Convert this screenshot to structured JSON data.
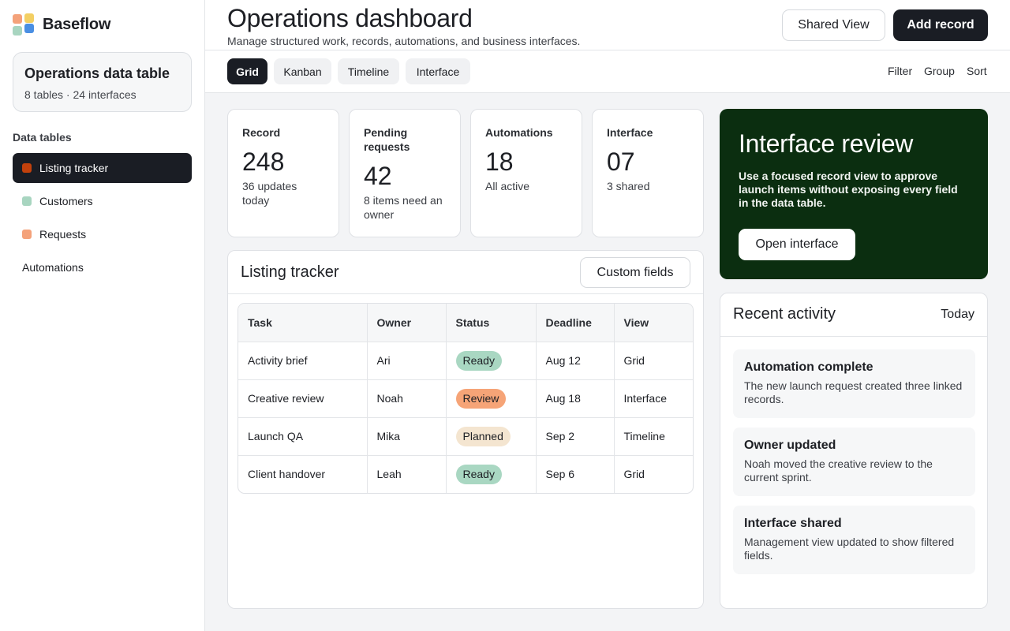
{
  "brand": {
    "name": "Baseflow"
  },
  "workspace": {
    "title": "Operations data table",
    "subtitle": "8 tables · 24 interfaces"
  },
  "sidebar": {
    "section_label": "Data tables",
    "items": [
      {
        "label": "Listing tracker",
        "color": "#c2410c",
        "active": true
      },
      {
        "label": "Customers",
        "color": "#a8d5c0",
        "active": false
      },
      {
        "label": "Requests",
        "color": "#f4a27a",
        "active": false
      }
    ],
    "automations_label": "Automations"
  },
  "header": {
    "title": "Operations dashboard",
    "subtitle": "Manage structured work, records, automations, and business interfaces.",
    "shared_view_label": "Shared View",
    "add_record_label": "Add record"
  },
  "tabs": {
    "grid": "Grid",
    "kanban": "Kanban",
    "timeline": "Timeline",
    "interface": "Interface"
  },
  "tools": {
    "filter": "Filter",
    "group": "Group",
    "sort": "Sort"
  },
  "stats": [
    {
      "label": "Record",
      "value": "248",
      "note": "36 updates today"
    },
    {
      "label": "Pending requests",
      "value": "42",
      "note": "8 items need an owner"
    },
    {
      "label": "Automations",
      "value": "18",
      "note": "All active"
    },
    {
      "label": "Interface",
      "value": "07",
      "note": "3 shared"
    }
  ],
  "hero": {
    "title": "Interface review",
    "body": "Use a focused record view to approve launch items without exposing every field in the data table.",
    "button": "Open interface",
    "background": "#0b2e10"
  },
  "table": {
    "title": "Listing tracker",
    "custom_fields_label": "Custom fields",
    "columns": [
      "Task",
      "Owner",
      "Status",
      "Deadline",
      "View"
    ],
    "rows": [
      {
        "task": "Activity brief",
        "owner": "Ari",
        "status": "Ready",
        "status_kind": "ready",
        "deadline": "Aug 12",
        "view": "Grid"
      },
      {
        "task": "Creative review",
        "owner": "Noah",
        "status": "Review",
        "status_kind": "review",
        "deadline": "Aug 18",
        "view": "Interface"
      },
      {
        "task": "Launch QA",
        "owner": "Mika",
        "status": "Planned",
        "status_kind": "planned",
        "deadline": "Sep 2",
        "view": "Timeline"
      },
      {
        "task": "Client handover",
        "owner": "Leah",
        "status": "Ready",
        "status_kind": "ready",
        "deadline": "Sep 6",
        "view": "Grid"
      }
    ]
  },
  "activity": {
    "title": "Recent activity",
    "date_label": "Today",
    "items": [
      {
        "title": "Automation complete",
        "body": "The new launch request created three linked records."
      },
      {
        "title": "Owner updated",
        "body": "Noah moved the creative review to the current sprint."
      },
      {
        "title": "Interface shared",
        "body": "Management view updated to show filtered fields."
      }
    ]
  }
}
